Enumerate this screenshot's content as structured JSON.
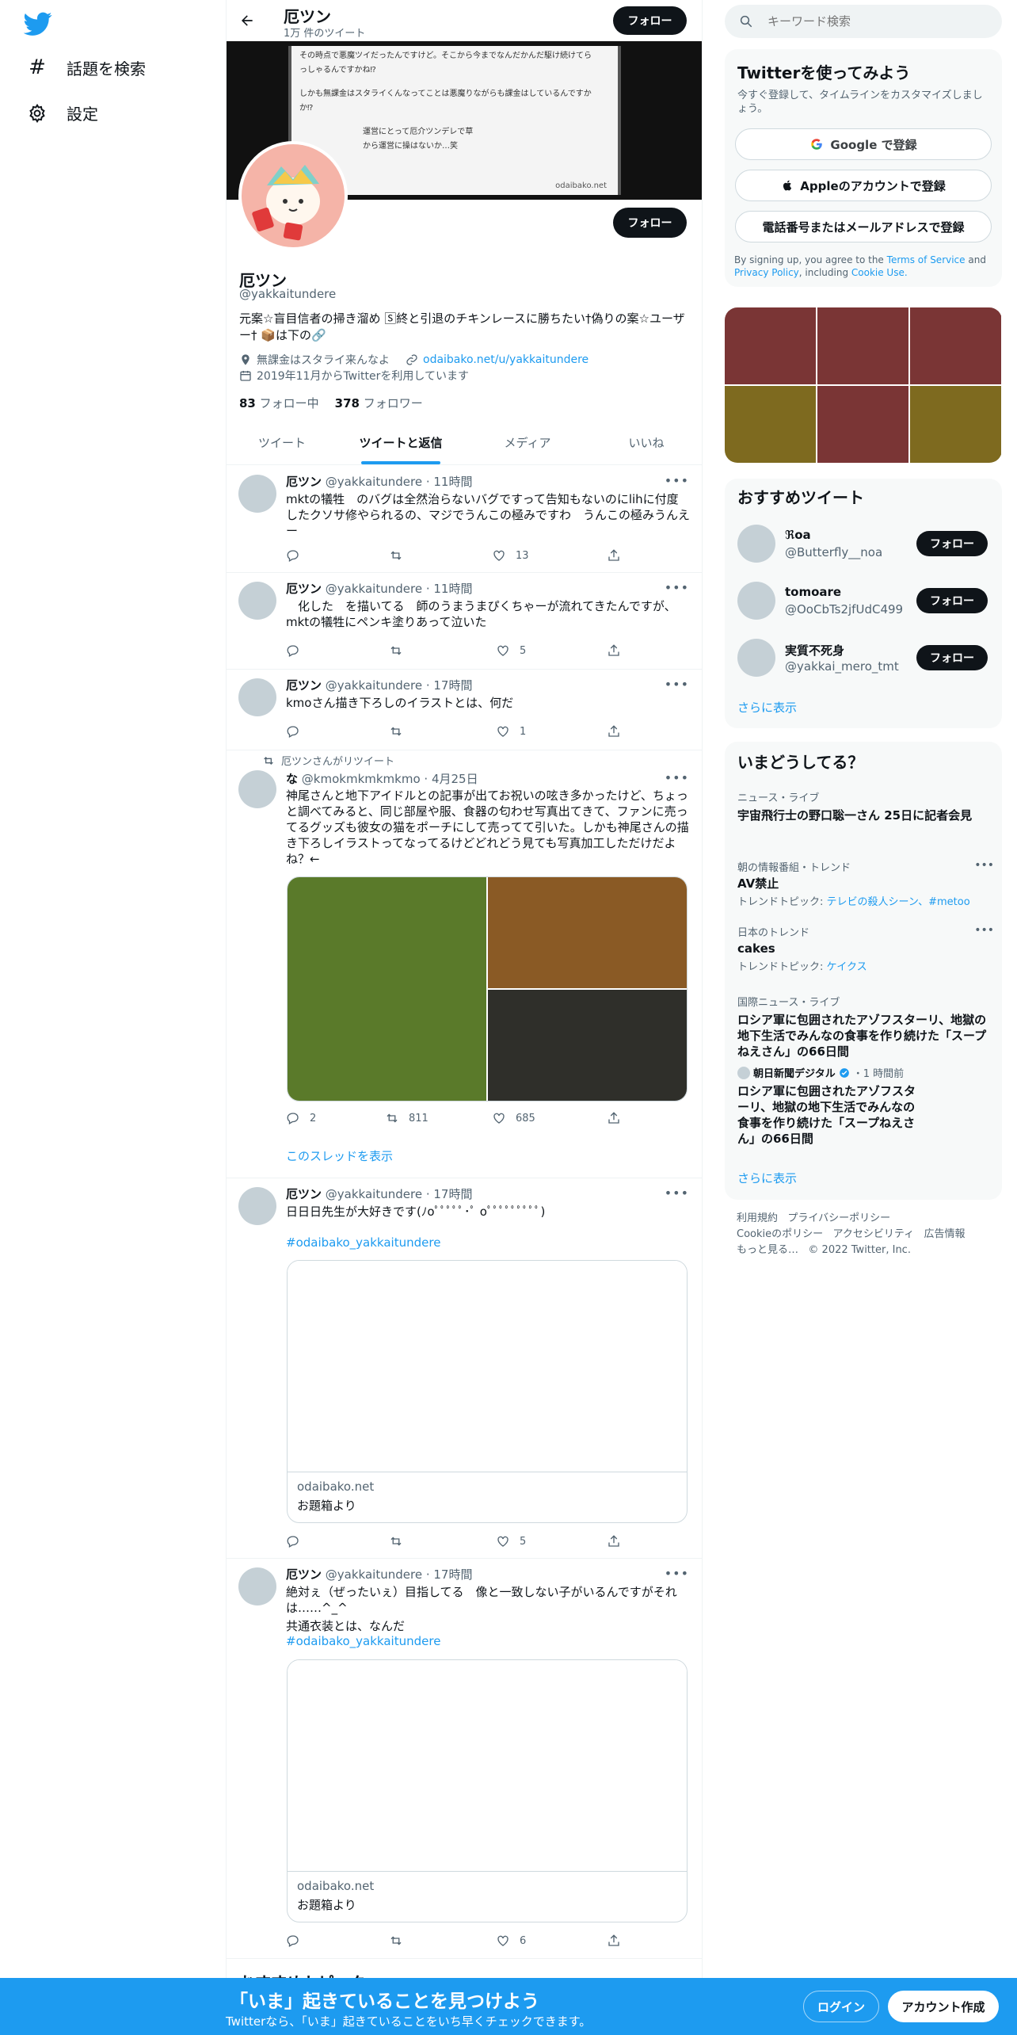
{
  "nav": {
    "explore_label": "話題を検索",
    "settings_label": "設定"
  },
  "header": {
    "name": "厄ツン",
    "tweet_count": "1万 件のツイート",
    "follow_label": "フォロー"
  },
  "banner": {
    "lines": [
      "その時点で悪魔ツイだったんですけど。そこから今までなんだかんだ駆け続けてら",
      "っしゃるんですかね⁉",
      "しかも無課金はスタライくんなってことは悪魔りながらも課金はしているんですか",
      "か⁉",
      "運営にとって厄介ツンデレで草",
      "から運営に操はないか…笑"
    ],
    "watermark": "odaibako.net"
  },
  "profile": {
    "name": "厄ツン",
    "handle": "@yakkaitundere",
    "follow_label": "フォロー",
    "bio": "元案☆盲目信者の掃き溜め 🅂終と引退のチキンレースに勝ちたい†偽りの案☆ユーザー† 📦は下の🔗",
    "location": "無課金はスタライ来んなよ",
    "url": "odaibako.net/u/yakkaitundere",
    "joined": "2019年11月からTwitterを利用しています",
    "following_count": "83",
    "following_label": "フォロー中",
    "followers_count": "378",
    "followers_label": "フォロワー"
  },
  "tabs": [
    {
      "label": "ツイート"
    },
    {
      "label": "ツイートと返信"
    },
    {
      "label": "メディア"
    },
    {
      "label": "いいね"
    }
  ],
  "tweets": [
    {
      "name": "厄ツン",
      "handle": "@yakkaitundere",
      "time": "11時間",
      "text": "mktの犠牲　のバグは全然治らないバグですって告知もないのにlihに付度したクソサ修やられるの、マジでうんこの極みですわ　うんこの極みうんえー",
      "reply": "",
      "retweet": "",
      "like": "13"
    },
    {
      "name": "厄ツン",
      "handle": "@yakkaitundere",
      "time": "11時間",
      "text": "　化した　を描いてる　師のうまうまぴくちゃーが流れてきたんですが、mktの犠牲にペンキ塗りあって泣いた",
      "reply": "",
      "retweet": "",
      "like": "5"
    },
    {
      "name": "厄ツン",
      "handle": "@yakkaitundere",
      "time": "17時間",
      "text": "kmoさん描き下ろしのイラストとは、何だ",
      "reply": "",
      "retweet": "",
      "like": "1"
    },
    {
      "retweeted_by": "厄ツンさんがリツイート",
      "name": "な",
      "handle": "@kmokmkmkmkmo",
      "time": "4月25日",
      "text": "神尾さんと地下アイドルとの記事が出てお祝いの呟き多かったけど、ちょっと調べてみると、同じ部屋や服、食器の匂わせ写真出てきて、ファンに売ってるグッズも彼女の猫をポーチにして売ってて引いた。しかも神尾さんの描き下ろしイラストってなってるけどどれどう見ても写真加工しただけだよね？←",
      "reply": "2",
      "retweet": "811",
      "like": "685",
      "thread_link": "このスレッドを表示"
    },
    {
      "name": "厄ツン",
      "handle": "@yakkaitundere",
      "time": "17時間",
      "text": "日日日先生が大好きです(ﾉoﾟﾟﾟﾟﾟ･ﾟ oﾟﾟﾟﾟﾟﾟﾟﾟﾟ)",
      "hashtag": "#odaibako_yakkaitundere",
      "card_domain": "odaibako.net",
      "card_title": "お題箱より",
      "reply": "",
      "retweet": "",
      "like": "5"
    },
    {
      "name": "厄ツン",
      "handle": "@yakkaitundere",
      "time": "17時間",
      "text": "絶対ぇ（ぜったいぇ）目指してる　像と一致しない子がいるんですがそれは……^_^",
      "text2": "共通衣装とは、なんだ",
      "hashtag": "#odaibako_yakkaitundere",
      "card_domain": "odaibako.net",
      "card_title": "お題箱より",
      "reply": "",
      "retweet": "",
      "like": "6"
    }
  ],
  "section_below": "おすすめトピック",
  "search": {
    "placeholder": "キーワード検索"
  },
  "signup": {
    "title": "Twitterを使ってみよう",
    "subtitle": "今すぐ登録して、タイムラインをカスタマイズしましょう。",
    "google": "Google で登録",
    "apple": "Appleのアカウントで登録",
    "phone": "電話番号またはメールアドレスで登録",
    "legal_pre": "By signing up, you agree to the",
    "tos": "Terms of Service",
    "and": "and",
    "privacy": "Privacy Policy",
    "including": ", including",
    "cookie": "Cookie Use."
  },
  "media_tiles": [
    "#7a3535",
    "#7a3535",
    "#7a3535",
    "#7e6a1f",
    "#7a3535",
    "#7e6a1f"
  ],
  "who_to_follow": {
    "title": "おすすめツイート",
    "users": [
      {
        "name": "ℜoa",
        "handle": "@Butterfly__noa",
        "button": "フォロー"
      },
      {
        "name": "tomoare",
        "handle": "@OoCbTs2jfUdC499",
        "button": "フォロー"
      },
      {
        "name": "実質不死身",
        "handle": "@yakkai_mero_tmt",
        "button": "フォロー"
      }
    ],
    "more": "さらに表示"
  },
  "trends": {
    "title": "いまどうしてる？",
    "items": [
      {
        "cat": "ニュース・ライブ",
        "title": "宇宙飛行士の野口聡一さん 25日に記者会見"
      },
      {
        "cat": "朝の情報番組・トレンド",
        "title": "AV禁止",
        "topic_label": "トレンドトピック:",
        "topics": "テレビの殺人シーン、#metoo"
      },
      {
        "cat": "日本のトレンド",
        "title": "cakes",
        "topic_label": "トレンドトピック:",
        "topics": "ケイクス"
      },
      {
        "cat": "国際ニュース・ライブ",
        "title": "ロシア軍に包囲されたアゾフスターリ、地獄の地下生活でみんなの食事を作り続けた「スープねえさん」の66日間"
      }
    ],
    "item1_source": "朝日新聞デジタル",
    "item1_time": "・1 時間前",
    "item0_time": "",
    "more": "さらに表示"
  },
  "footer": {
    "links": [
      "利用規約",
      "プライバシーポリシー",
      "Cookieのポリシー",
      "アクセシビリティ",
      "広告情報",
      "もっと見る…"
    ],
    "copyright": "© 2022 Twitter, Inc."
  },
  "bottom_bar": {
    "title": "「いま」起きていることを見つけよう",
    "subtitle": "Twitterなら、「いま」起きていることをいち早くチェックできます。",
    "login": "ログイン",
    "signup": "アカウント作成"
  },
  "colors": {
    "brand": "#1d9bf0",
    "dark": "#0f1419",
    "muted": "#536471"
  }
}
